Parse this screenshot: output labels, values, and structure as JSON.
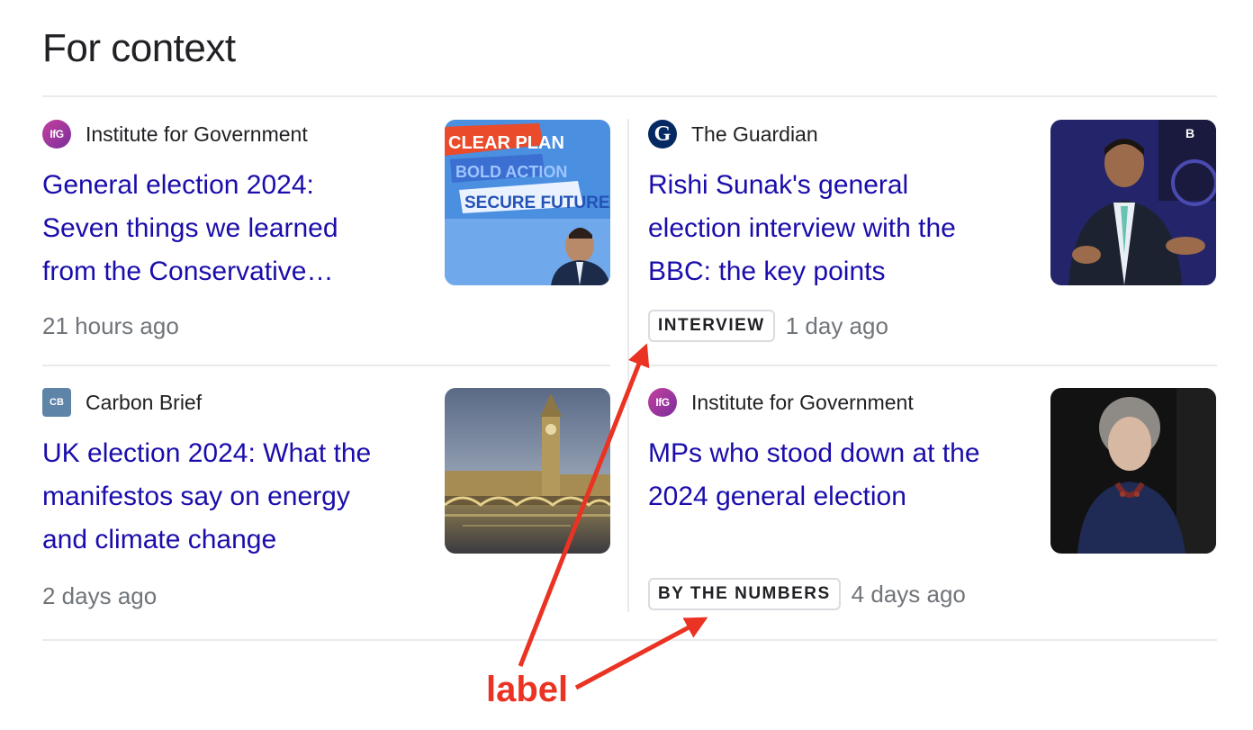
{
  "heading": "For context",
  "articles": [
    {
      "source": "Institute for Government",
      "source_icon": "ifg-logo-icon",
      "source_icon_text": "IfG",
      "title_lines": [
        "General election 2024:",
        "Seven things we learned",
        "from the Conservative…"
      ],
      "badge": "",
      "time": "21 hours ago",
      "image_icon": "campaign-rally-image"
    },
    {
      "source": "The Guardian",
      "source_icon": "guardian-logo-icon",
      "source_icon_text": "G",
      "title_lines": [
        "Rishi Sunak's general",
        "election interview with the",
        "BBC: the key points"
      ],
      "badge": "INTERVIEW",
      "time": "1 day ago",
      "image_icon": "interview-portrait-image"
    },
    {
      "source": "Carbon Brief",
      "source_icon": "carbon-brief-logo-icon",
      "source_icon_text": "CB",
      "title_lines": [
        "UK election 2024: What the",
        "manifestos say on energy",
        "and climate change"
      ],
      "badge": "",
      "time": "2 days ago",
      "image_icon": "westminster-image"
    },
    {
      "source": "Institute for Government",
      "source_icon": "ifg-logo-icon",
      "source_icon_text": "IfG",
      "title_lines": [
        "MPs who stood down at the",
        "2024 general election"
      ],
      "badge": "BY THE NUMBERS",
      "time": "4 days ago",
      "image_icon": "speaker-portrait-image"
    }
  ],
  "annotation": {
    "label": "label",
    "color": "#ea3323"
  },
  "colors": {
    "link": "#1a0dab",
    "meta": "#70757a",
    "divider": "#e8eaed"
  }
}
